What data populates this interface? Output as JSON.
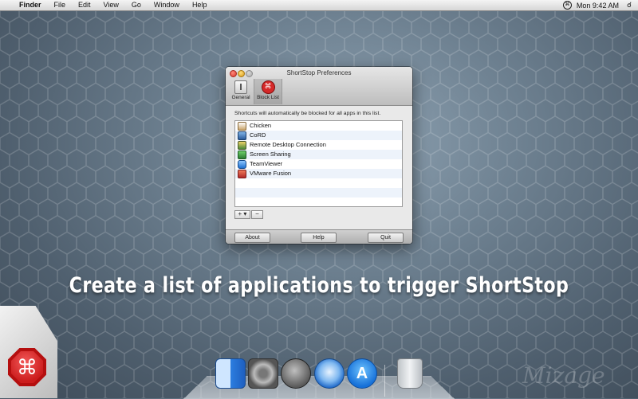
{
  "menubar": {
    "apple": "",
    "app": "Finder",
    "items": [
      "File",
      "Edit",
      "View",
      "Go",
      "Window",
      "Help"
    ],
    "status_icon": "shortstop-status-icon",
    "clock": "Mon 9:42 AM",
    "spotlight": "spotlight-icon"
  },
  "window": {
    "title": "ShortStop Preferences",
    "toolbar": {
      "general": "General",
      "block_list": "Block List"
    },
    "description": "Shortcuts will automatically be blocked for all apps in this list.",
    "apps": [
      "Chicken",
      "CoRD",
      "Remote Desktop Connection",
      "Screen Sharing",
      "TeamViewer",
      "VMware Fusion"
    ],
    "add_label": "+ ▾",
    "remove_label": "−",
    "buttons": {
      "about": "About",
      "help": "Help",
      "quit": "Quit"
    }
  },
  "tagline": "Create a list of applications to trigger ShortStop",
  "badge_symbol": "⌘",
  "dock": [
    "Finder",
    "System Preferences",
    "Launchpad",
    "Safari",
    "App Store",
    "Trash"
  ],
  "appstore_glyph": "A",
  "watermark": "Mizage",
  "colors": {
    "badge": "#cc1d1d",
    "row_alt": "#edf3fb"
  }
}
